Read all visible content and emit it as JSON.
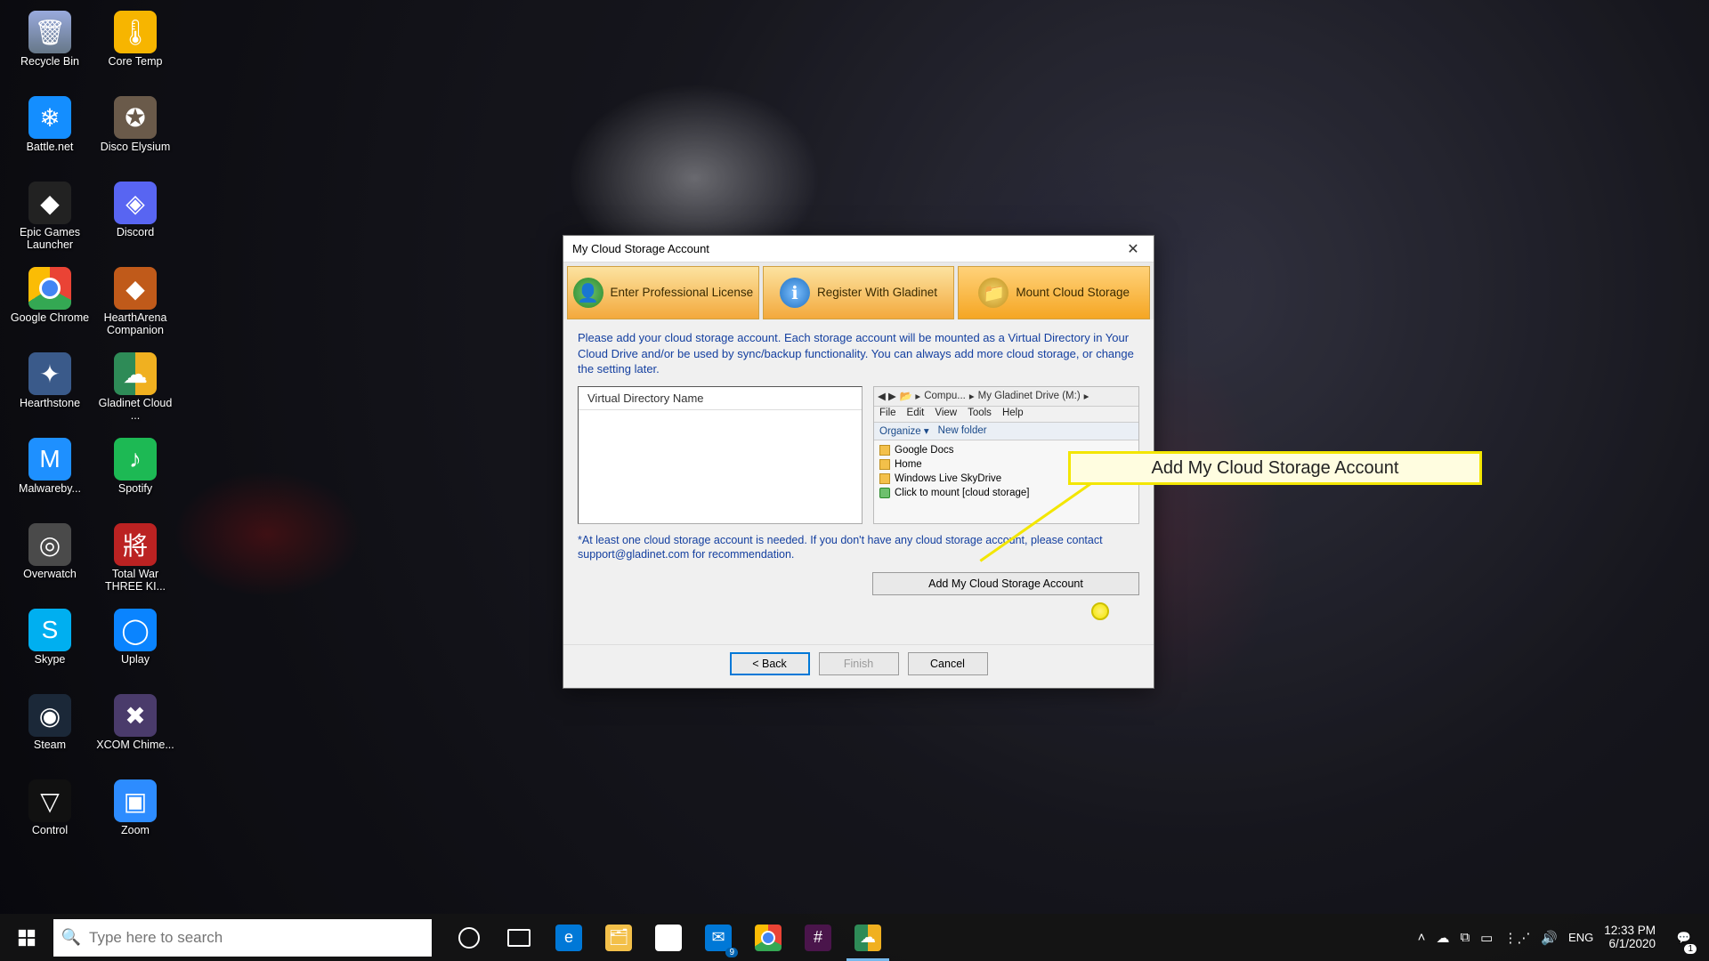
{
  "desktop_icons": [
    {
      "label": "Recycle Bin",
      "cls": "ico-bin",
      "glyph": "🗑"
    },
    {
      "label": "Battle.net",
      "cls": "ico-bnet",
      "glyph": "❄"
    },
    {
      "label": "Epic Games Launcher",
      "cls": "ico-epic",
      "glyph": "◆"
    },
    {
      "label": "Google Chrome",
      "cls": "ico-chrome",
      "glyph": ""
    },
    {
      "label": "Hearthstone",
      "cls": "ico-hs",
      "glyph": "✦"
    },
    {
      "label": "Malwareby...",
      "cls": "ico-mwb",
      "glyph": "M"
    },
    {
      "label": "Overwatch",
      "cls": "ico-ow",
      "glyph": "◎"
    },
    {
      "label": "Skype",
      "cls": "ico-skype",
      "glyph": "S"
    },
    {
      "label": "Steam",
      "cls": "ico-steam",
      "glyph": "◉"
    },
    {
      "label": "Control",
      "cls": "ico-control",
      "glyph": "▽"
    },
    {
      "label": "Core Temp",
      "cls": "ico-coretemp",
      "glyph": "🌡"
    },
    {
      "label": "Disco Elysium",
      "cls": "ico-disco",
      "glyph": "✪"
    },
    {
      "label": "Discord",
      "cls": "ico-discord",
      "glyph": "◈"
    },
    {
      "label": "HearthArena Companion",
      "cls": "ico-ha",
      "glyph": "◆"
    },
    {
      "label": "Gladinet Cloud ...",
      "cls": "ico-glad",
      "glyph": "☁"
    },
    {
      "label": "Spotify",
      "cls": "ico-spotify",
      "glyph": "♪"
    },
    {
      "label": "Total War THREE KI...",
      "cls": "ico-tw",
      "glyph": "將"
    },
    {
      "label": "Uplay",
      "cls": "ico-uplay",
      "glyph": "◯"
    },
    {
      "label": "XCOM Chime...",
      "cls": "ico-xcom",
      "glyph": "✖"
    },
    {
      "label": "Zoom",
      "cls": "ico-zoom",
      "glyph": "▣"
    }
  ],
  "dialog": {
    "title": "My Cloud Storage Account",
    "tabs": [
      {
        "label": "Enter Professional License",
        "icon_cls": "ti-green",
        "glyph": "👤"
      },
      {
        "label": "Register With Gladinet",
        "icon_cls": "ti-blue",
        "glyph": "ℹ"
      },
      {
        "label": "Mount Cloud Storage",
        "icon_cls": "ti-gold",
        "glyph": "📁"
      }
    ],
    "intro": "Please add your cloud storage account. Each storage account will be mounted as a Virtual Directory in Your Cloud Drive and/or be used by sync/backup functionality. You can always add more cloud storage, or change the setting later.",
    "vd_header": "Virtual Directory Name",
    "explorer": {
      "crumbs": [
        "Compu...",
        "My Gladinet Drive (M:)"
      ],
      "menu": [
        "File",
        "Edit",
        "View",
        "Tools",
        "Help"
      ],
      "toolbar": [
        "Organize ▾",
        "New folder"
      ],
      "items": [
        {
          "label": "Google Docs",
          "green": false
        },
        {
          "label": "Home",
          "green": false
        },
        {
          "label": "Windows Live SkyDrive",
          "green": false
        },
        {
          "label": "Click to mount [cloud storage]",
          "green": true
        }
      ]
    },
    "footnote": "*At least one cloud storage account is needed. If you don't have any cloud storage account, please contact support@gladinet.com for recommendation.",
    "add_button": "Add My Cloud Storage Account",
    "buttons": {
      "back": "< Back",
      "finish": "Finish",
      "cancel": "Cancel"
    }
  },
  "callout": {
    "text": "Add My Cloud Storage Account"
  },
  "taskbar": {
    "search_placeholder": "Type here to search",
    "items": [
      {
        "name": "edge",
        "cls": "ic-edge",
        "glyph": "e"
      },
      {
        "name": "file-explorer",
        "cls": "ic-files",
        "glyph": "🗂"
      },
      {
        "name": "microsoft-store",
        "cls": "ic-store",
        "glyph": "🛍"
      },
      {
        "name": "mail",
        "cls": "ic-mail",
        "glyph": "✉",
        "badge": "9"
      },
      {
        "name": "chrome",
        "cls": "ic-chrome2",
        "glyph": ""
      },
      {
        "name": "slack",
        "cls": "ic-slack",
        "glyph": "#"
      },
      {
        "name": "gladinet",
        "cls": "ic-glad2",
        "glyph": "☁",
        "active": true
      }
    ],
    "tray_lang": "ENG",
    "tray_time": "12:33 PM",
    "tray_date": "6/1/2020",
    "tray_notif_count": "1"
  }
}
